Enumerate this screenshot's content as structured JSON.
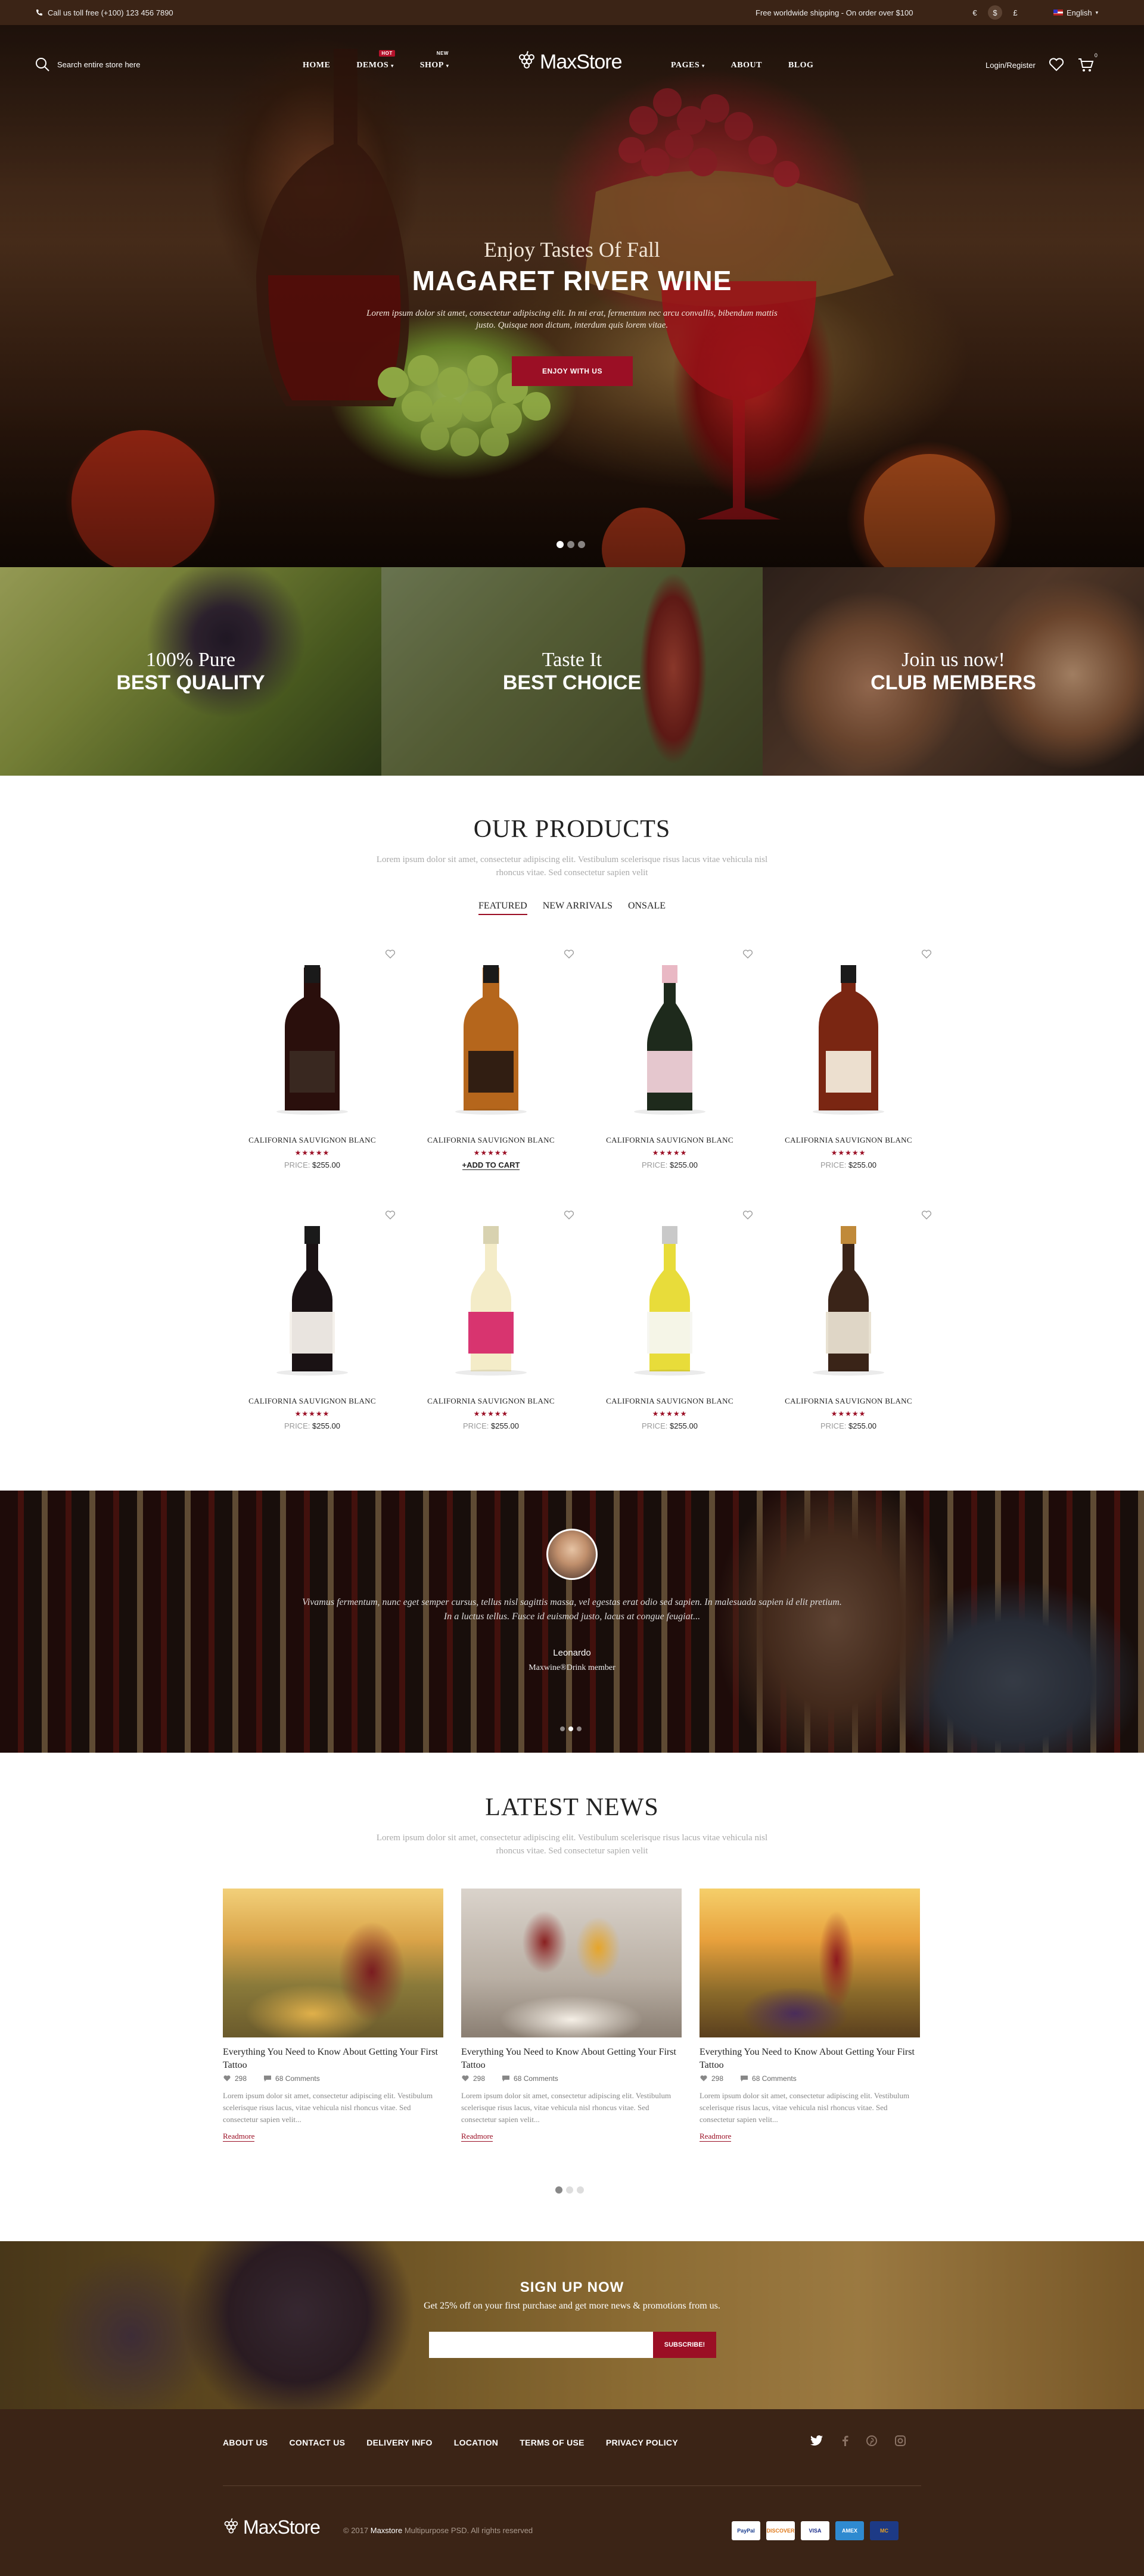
{
  "topbar": {
    "phone": "Call us toll free (+100) 123 456 7890",
    "shipping": "Free worldwide shipping - On order over $100",
    "currencies": [
      "€",
      "$",
      "£"
    ],
    "language": "English"
  },
  "nav": {
    "search_placeholder": "Search entire store here",
    "menu_left": [
      {
        "label": "HOME",
        "badge": ""
      },
      {
        "label": "DEMOS",
        "badge": "HOT"
      },
      {
        "label": "SHOP",
        "badge": "NEW"
      }
    ],
    "menu_right": [
      {
        "label": "PAGES"
      },
      {
        "label": "ABOUT"
      },
      {
        "label": "BLOG"
      }
    ],
    "logo": "MaxStore",
    "login": "Login/Register",
    "cart_count": "0"
  },
  "hero": {
    "subtitle": "Enjoy Tastes Of Fall",
    "title": "MAGARET RIVER WINE",
    "description": "Lorem ipsum dolor sit amet, consectetur adipiscing elit. In mi erat, fermentum nec arcu convallis, bibendum mattis justo. Quisque non dictum, interdum quis lorem vitae.",
    "button": "ENJOY WITH US"
  },
  "banners": [
    {
      "line1": "100% Pure",
      "line2": "BEST QUALITY"
    },
    {
      "line1": "Taste It",
      "line2": "BEST CHOICE"
    },
    {
      "line1": "Join us now!",
      "line2": "CLUB MEMBERS"
    }
  ],
  "products_section": {
    "title": "OUR PRODUCTS",
    "description": "Lorem ipsum dolor sit amet, consectetur adipiscing elit. Vestibulum scelerisque risus lacus vitae vehicula nisl rhoncus vitae. Sed consectetur sapien velit",
    "tabs": [
      "FEATURED",
      "NEW ARRIVALS",
      "ONSALE"
    ]
  },
  "products": [
    {
      "name": "CALIFORNIA SAUVIGNON BLANC",
      "price_label": "PRICE:",
      "price": "$255.00",
      "rating": "★★★★★",
      "style": "black-bottle"
    },
    {
      "name": "CALIFORNIA SAUVIGNON BLANC",
      "price_label": "",
      "price": "",
      "cart": "+ADD TO CART",
      "rating": "★★★★★",
      "style": "whiskey"
    },
    {
      "name": "CALIFORNIA SAUVIGNON BLANC",
      "price_label": "PRICE:",
      "price": "$255.00",
      "rating": "★★★★★",
      "style": "champagne"
    },
    {
      "name": "CALIFORNIA SAUVIGNON BLANC",
      "price_label": "PRICE:",
      "price": "$255.00",
      "rating": "★★★★★",
      "style": "cognac"
    },
    {
      "name": "CALIFORNIA SAUVIGNON BLANC",
      "price_label": "PRICE:",
      "price": "$255.00",
      "rating": "★★★★★",
      "style": "red-wine"
    },
    {
      "name": "CALIFORNIA SAUVIGNON BLANC",
      "price_label": "PRICE:",
      "price": "$255.00",
      "rating": "★★★★★",
      "style": "rose"
    },
    {
      "name": "CALIFORNIA SAUVIGNON BLANC",
      "price_label": "PRICE:",
      "price": "$255.00",
      "rating": "★★★★★",
      "style": "white"
    },
    {
      "name": "CALIFORNIA SAUVIGNON BLANC",
      "price_label": "PRICE:",
      "price": "$255.00",
      "rating": "★★★★★",
      "style": "dark"
    }
  ],
  "testimonial": {
    "quote": "Vivamus fermentum, nunc eget semper cursus, tellus nisl sagittis massa, vel egestas erat odio sed sapien. In malesuada sapien id elit pretium. In a luctus tellus. Fusce id euismod justo, lacus at congue feugiat...",
    "name": "Leonardo",
    "role": "Maxwine®Drink member"
  },
  "news_section": {
    "title": "LATEST NEWS",
    "description": "Lorem ipsum dolor sit amet, consectetur adipiscing elit. Vestibulum scelerisque risus lacus vitae vehicula nisl rhoncus vitae. Sed consectetur sapien velit"
  },
  "news": [
    {
      "title": "Everything You Need to Know About Getting Your First Tattoo",
      "likes": "298",
      "comments": "68 Comments",
      "excerpt": "Lorem ipsum dolor sit amet, consectetur adipiscing elit. Vestibulum scelerisque risus lacus, vitae vehicula nisl rhoncus vitae. Sed consectetur sapien velit...",
      "more": "Readmore"
    },
    {
      "title": "Everything You Need to Know About Getting Your First Tattoo",
      "likes": "298",
      "comments": "68 Comments",
      "excerpt": "Lorem ipsum dolor sit amet, consectetur adipiscing elit. Vestibulum scelerisque risus lacus, vitae vehicula nisl rhoncus vitae. Sed consectetur sapien velit...",
      "more": "Readmore"
    },
    {
      "title": "Everything You Need to Know About Getting Your First Tattoo",
      "likes": "298",
      "comments": "68 Comments",
      "excerpt": "Lorem ipsum dolor sit amet, consectetur adipiscing elit. Vestibulum scelerisque risus lacus, vitae vehicula nisl rhoncus vitae. Sed consectetur sapien velit...",
      "more": "Readmore"
    }
  ],
  "signup": {
    "title": "SIGN UP NOW",
    "description": "Get 25% off on your first purchase and get more news & promotions from us.",
    "input_value": "",
    "button": "SUBSCRIBE!"
  },
  "footer": {
    "links": [
      "ABOUT US",
      "CONTACT US",
      "DELIVERY INFO",
      "LOCATION",
      "TERMS OF USE",
      "PRIVACY POLICY"
    ],
    "logo": "MaxStore",
    "copyright_pre": "© 2017",
    "copyright_brand": "Maxstore",
    "copyright_post": "Multipurpose PSD. All rights reserved",
    "payments": [
      "PayPal",
      "DISCOVER",
      "VISA",
      "AMEX",
      "MC"
    ]
  },
  "colors": {
    "accent": "#9b0f25",
    "dark_brown": "#3b2416"
  }
}
